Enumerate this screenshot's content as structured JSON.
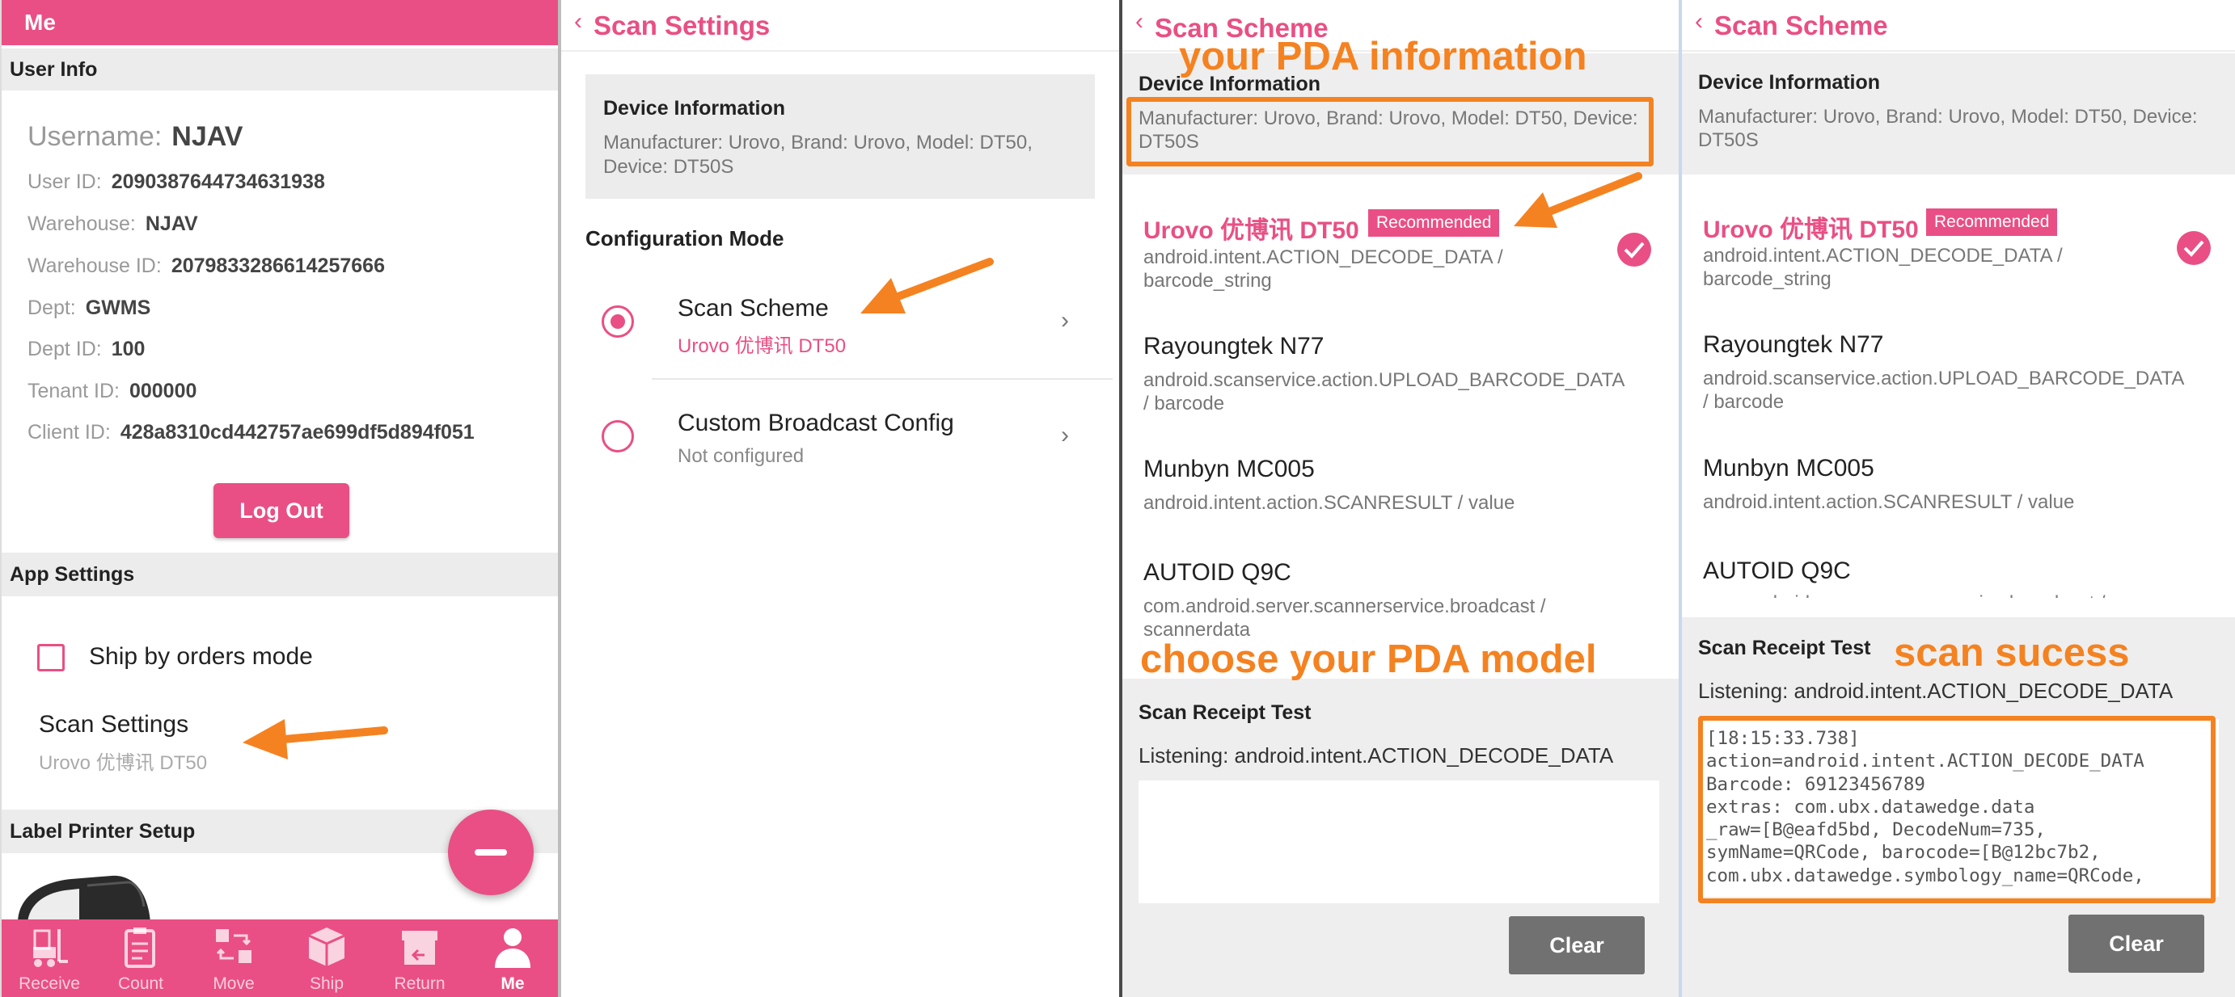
{
  "panel_me": {
    "title": "Me",
    "user_info_header": "User Info",
    "username_label": "Username:",
    "username": "NJAV",
    "user_id_label": "User ID:",
    "user_id": "2090387644734631938",
    "warehouse_label": "Warehouse:",
    "warehouse": "NJAV",
    "warehouse_id_label": "Warehouse ID:",
    "warehouse_id": "2079833286614257666",
    "dept_label": "Dept:",
    "dept": "GWMS",
    "dept_id_label": "Dept ID:",
    "dept_id": "100",
    "tenant_id_label": "Tenant ID:",
    "tenant_id": "000000",
    "client_id_label": "Client ID:",
    "client_id": "428a8310cd442757ae699df5d894f051",
    "logout_label": "Log Out",
    "app_settings_header": "App Settings",
    "ship_by_orders_label": "Ship by orders mode",
    "ship_by_orders_checked": false,
    "scan_settings_label": "Scan Settings",
    "scan_settings_value": "Urovo 优博讯 DT50",
    "label_printer_header": "Label Printer Setup",
    "nav": [
      {
        "label": "Receive",
        "icon": "forklift-icon"
      },
      {
        "label": "Count",
        "icon": "clipboard-icon"
      },
      {
        "label": "Move",
        "icon": "move-arrows-icon"
      },
      {
        "label": "Ship",
        "icon": "box-icon"
      },
      {
        "label": "Return",
        "icon": "return-box-icon"
      },
      {
        "label": "Me",
        "icon": "person-icon",
        "active": true
      }
    ]
  },
  "panel_scan_settings": {
    "title": "Scan Settings",
    "device_info_header": "Device Information",
    "device_info_text": "Manufacturer: Urovo, Brand: Urovo, Model: DT50, Device: DT50S",
    "config_mode_header": "Configuration Mode",
    "options": [
      {
        "title": "Scan Scheme",
        "subtitle": "Urovo 优博讯 DT50",
        "selected": true
      },
      {
        "title": "Custom Broadcast Config",
        "subtitle": "Not configured",
        "selected": false
      }
    ]
  },
  "panel_scan_scheme_1": {
    "title": "Scan Scheme",
    "device_info_header": "Device Information",
    "device_info_text": "Manufacturer: Urovo, Brand: Urovo, Model: DT50, Device: DT50S",
    "schemes": [
      {
        "name": "Urovo 优博讯 DT50",
        "badge": "Recommended",
        "desc": "android.intent.ACTION_DECODE_DATA / barcode_string",
        "selected": true
      },
      {
        "name": "Rayoungtek N77",
        "desc": "android.scanservice.action.UPLOAD_BARCODE_DATA / barcode"
      },
      {
        "name": "Munbyn MC005",
        "desc": "android.intent.action.SCANRESULT / value"
      },
      {
        "name": "AUTOID Q9C",
        "desc": "com.android.server.scannerservice.broadcast / scannerdata"
      }
    ],
    "scan_receipt_header": "Scan Receipt Test",
    "listening_text": "Listening: android.intent.ACTION_DECODE_DATA",
    "log": "",
    "clear_label": "Clear"
  },
  "panel_scan_scheme_2": {
    "title": "Scan Scheme",
    "device_info_header": "Device Information",
    "device_info_text": "Manufacturer: Urovo, Brand: Urovo, Model: DT50, Device: DT50S",
    "schemes": [
      {
        "name": "Urovo 优博讯 DT50",
        "badge": "Recommended",
        "desc": "android.intent.ACTION_DECODE_DATA / barcode_string",
        "selected": true
      },
      {
        "name": "Rayoungtek N77",
        "desc": "android.scanservice.action.UPLOAD_BARCODE_DATA / barcode"
      },
      {
        "name": "Munbyn MC005",
        "desc": "android.intent.action.SCANRESULT / value"
      },
      {
        "name": "AUTOID Q9C",
        "desc": "com.android.server.scannerservice.broadcast /"
      }
    ],
    "scan_receipt_header": "Scan Receipt Test",
    "listening_text": "Listening: android.intent.ACTION_DECODE_DATA",
    "log": "[18:15:33.738]\naction=android.intent.ACTION_DECODE_DATA\nBarcode: 69123456789\nextras: com.ubx.datawedge.data\n_raw=[B@eafd5bd, DecodeNum=735,\nsymName=QRCode, barocode=[B@12bc7b2,\ncom.ubx.datawedge.symbology_name=QRCode,",
    "clear_label": "Clear"
  },
  "annotations": {
    "pda_info": "your PDA information",
    "choose_model": "choose your PDA model",
    "scan_success": "scan sucess"
  },
  "colors": {
    "brand": "#e94f84",
    "annotation": "#f58220",
    "clear_button": "#717171"
  }
}
